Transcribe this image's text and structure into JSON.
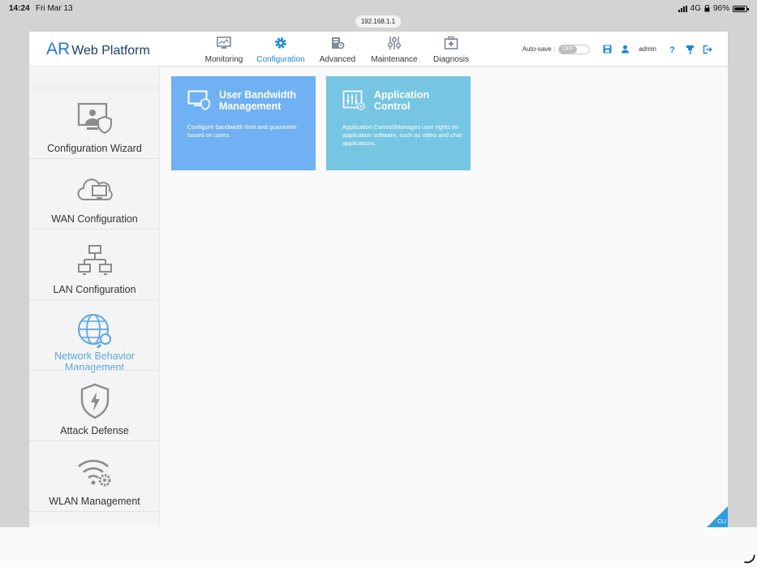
{
  "status_bar": {
    "time": "14:24",
    "date": "Fri Mar 13",
    "network": "4G",
    "battery": "96%"
  },
  "browser": {
    "url": "192.168.1.1"
  },
  "header": {
    "logo_ar": "AR",
    "logo_text": "Web Platform",
    "nav": [
      {
        "label": "Monitoring",
        "icon": "monitoring-icon"
      },
      {
        "label": "Configuration",
        "icon": "gear-icon",
        "active": true
      },
      {
        "label": "Advanced",
        "icon": "advanced-icon"
      },
      {
        "label": "Maintenance",
        "icon": "sliders-icon"
      },
      {
        "label": "Diagnosis",
        "icon": "medkit-icon"
      }
    ],
    "autosave_label": "Auto-save :",
    "autosave_state": "OFF",
    "username": "admin"
  },
  "sidebar": {
    "items": [
      {
        "label": "Configuration Wizard",
        "icon": "monitor-shield-icon"
      },
      {
        "label": "WAN Configuration",
        "icon": "cloud-monitor-icon"
      },
      {
        "label": "LAN Configuration",
        "icon": "lan-topology-icon"
      },
      {
        "label": "Network Behavior Management",
        "icon": "globe-wrench-icon",
        "active": true
      },
      {
        "label": "Attack Defense",
        "icon": "shield-bolt-icon"
      },
      {
        "label": "WLAN Management",
        "icon": "wifi-gear-icon"
      }
    ]
  },
  "cards": [
    {
      "title": "User Bandwidth Management",
      "description": "Configure bandwidth limit and guarantee based on users.",
      "color": "#6fb1f3"
    },
    {
      "title": "Application Control",
      "description": "Application Control/Manages user rights on application software, such as video and chat applications.",
      "color": "#75c5e3"
    }
  ],
  "cli_label": "CLI",
  "colors": {
    "accent": "#1f86d9",
    "brand": "#2478c8"
  }
}
